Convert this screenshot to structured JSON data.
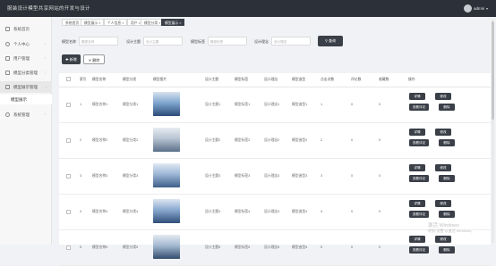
{
  "header": {
    "title": "服装设计模型共享网站的开发与设计",
    "user": "admin"
  },
  "sidebar": {
    "items": [
      {
        "label": "系统首页",
        "icon": "home-icon"
      },
      {
        "label": "个人中心",
        "icon": "user-icon"
      },
      {
        "label": "用户管理",
        "icon": "users-icon"
      },
      {
        "label": "模型分类管理",
        "icon": "category-icon"
      },
      {
        "label": "模型展示管理",
        "icon": "grid-icon"
      },
      {
        "label": "系统管理",
        "icon": "settings-icon"
      }
    ],
    "sub_item": "模型展示"
  },
  "tabs": [
    "系统首页",
    "模型展示 ×",
    "个人信息 ×",
    "用户 ×",
    "模型分类 ×",
    "模型展示 ×"
  ],
  "search": {
    "name_label": "模型名称",
    "name_placeholder": "模型名称",
    "design_label": "设计主题",
    "design_placeholder": "设计主题",
    "tag_label": "模型标签",
    "tag_placeholder": "模型标签",
    "concept_label": "设计理念",
    "concept_placeholder": "设计理念",
    "button": "⚲ 查询"
  },
  "actions": {
    "add": "✚ 新增",
    "delete": "✕ 删除"
  },
  "table": {
    "columns": [
      "索引",
      "模型名称",
      "模型分类",
      "模型图片",
      "设计主题",
      "模型标签",
      "设计理念",
      "模型造型",
      "点击次数",
      "评论数",
      "收藏数",
      "操作"
    ],
    "row_buttons": {
      "detail": "详情",
      "edit": "修改",
      "comment": "查看评论",
      "remove": "删除"
    },
    "rows": [
      {
        "index": "1",
        "name": "模型名称1",
        "category": "模型分类1",
        "theme": "设计主题1",
        "tag": "模型标签1",
        "concept": "设计理念1",
        "shape": "模型造型1",
        "clicks": "1",
        "comments": "0",
        "favorites": "0"
      },
      {
        "index": "2",
        "name": "模型名称2",
        "category": "模型分类2",
        "theme": "设计主题2",
        "tag": "模型标签2",
        "concept": "设计理念2",
        "shape": "模型造型2",
        "clicks": "2",
        "comments": "0",
        "favorites": "0"
      },
      {
        "index": "3",
        "name": "模型名称3",
        "category": "模型分类3",
        "theme": "设计主题3",
        "tag": "模型标签3",
        "concept": "设计理念3",
        "shape": "模型造型3",
        "clicks": "3",
        "comments": "0",
        "favorites": "0"
      },
      {
        "index": "4",
        "name": "模型名称4",
        "category": "模型分类4",
        "theme": "设计主题4",
        "tag": "模型标签4",
        "concept": "设计理念4",
        "shape": "模型造型4",
        "clicks": "4",
        "comments": "0",
        "favorites": "0"
      },
      {
        "index": "5",
        "name": "模型名称5",
        "category": "模型分类5",
        "theme": "设计主题5",
        "tag": "模型标签5",
        "concept": "设计理念5",
        "shape": "模型造型5",
        "clicks": "5",
        "comments": "0",
        "favorites": "0"
      }
    ]
  },
  "watermark": {
    "line1": "激活 Windows",
    "line2": "转到“设置”以激活 Windows。"
  }
}
